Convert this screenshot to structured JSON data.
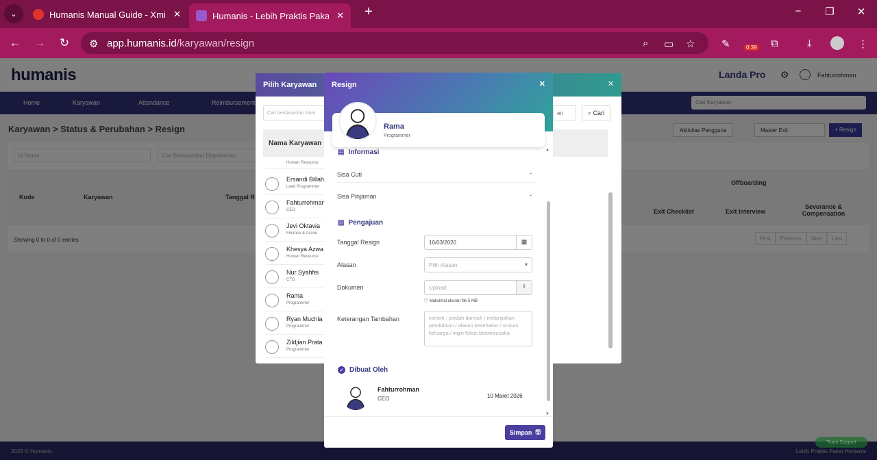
{
  "browser": {
    "tabs": [
      {
        "title": "Humanis Manual Guide - Xmind",
        "close": "✕"
      },
      {
        "title": "Humanis - Lebih Praktis Pakai H",
        "close": "✕"
      }
    ],
    "new_tab": "+",
    "url_domain": "app.humanis.id",
    "url_path": "/karyawan/resign",
    "extension_badge": "0:39",
    "window_controls": [
      "−",
      "❐",
      "✕"
    ]
  },
  "app": {
    "logo": "humanis",
    "company": "Landa Pro",
    "user": "Fahturrohman",
    "nav": [
      "Home",
      "Karyawan",
      "Attendance",
      "Reimbursement"
    ],
    "search_placeholder": "Cari Karyawan",
    "breadcrumb": "Karyawan > Status & Perubahan > Resign",
    "actions": [
      "Aktivitas Pengguna",
      "Master Exit",
      "+ Resign"
    ],
    "filters": [
      "Isi Nama",
      "Cari Berdasarkan Departemen"
    ],
    "table_headers": [
      "Kode",
      "Karyawan",
      "Tanggal R",
      "Offboarding",
      "Exit Checklist",
      "Exit Interview",
      "Severance & Compensation"
    ],
    "entries_info": "Showing 0 to 0 of 0 entries",
    "pagination": [
      "First",
      "Previous",
      "Next",
      "Last"
    ],
    "footer_left": "2026 © Humanis.",
    "footer_right": "Lebih Praktis Pakai Humanis",
    "support": "Team Support"
  },
  "back_modal": {
    "title": "Pilih Karyawan",
    "search_placeholder": "Cari berdasarkan Nam",
    "select_suffix": "en",
    "search_button": "Cari",
    "column": "Nama Karyawan",
    "rows": [
      {
        "name": "",
        "role": "Human Resource"
      },
      {
        "name": "Ersandi Billah",
        "role": "Lead Programmer"
      },
      {
        "name": "Fahturrohman",
        "role": "CEO"
      },
      {
        "name": "Jevi Oktavia",
        "role": "Finance & Accou"
      },
      {
        "name": "Khesya Azwa",
        "role": "Human Resource"
      },
      {
        "name": "Nur Syahfei",
        "role": "CTO"
      },
      {
        "name": "Rama",
        "role": "Programmer"
      },
      {
        "name": "Ryan Muchla",
        "role": "Programmer"
      },
      {
        "name": "Zildjian Prata",
        "role": "Programmer"
      }
    ]
  },
  "modal": {
    "title": "Resign",
    "employee_name": "Rama",
    "employee_role": "Programmer",
    "informasi_title": "Informasi",
    "sisa_cuti_label": "Sisa Cuti",
    "sisa_cuti_value": "-",
    "sisa_pinjaman_label": "Sisa Pinjaman",
    "sisa_pinjaman_value": "-",
    "pengajuan_title": "Pengajuan",
    "tanggal_label": "Tanggal Resign",
    "tanggal_value": "10/03/2026",
    "alasan_label": "Alasan",
    "alasan_placeholder": "Pilih Alasan",
    "dokumen_label": "Dokumen",
    "dokumen_placeholder": "Upload",
    "dokumen_hint": "Maksimal ukuran file 5 MB",
    "keterangan_label": "Keterangan Tambahan",
    "keterangan_placeholder": "contoh : pindah domisili / melanjutkan pendidikan / alasan kesehatan / urusan keluarga / ingin fokus berwirausaha",
    "dibuat_title": "Dibuat Oleh",
    "creator_name": "Fahturrohman",
    "creator_role": "CEO",
    "created_date": "10 Maret 2026",
    "save_label": "Simpan"
  }
}
